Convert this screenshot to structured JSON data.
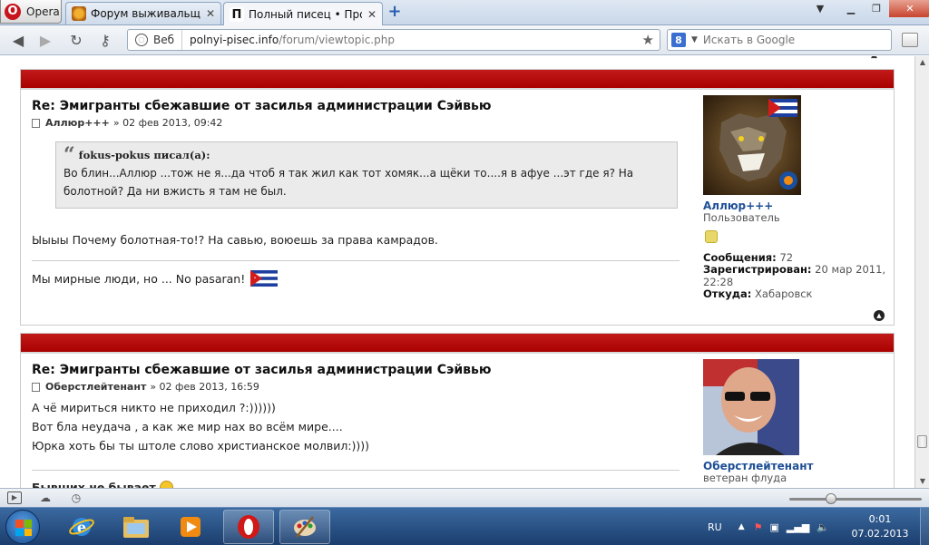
{
  "browser": {
    "menu_label": "Opera",
    "tabs": [
      {
        "title": "Форум выживальщик...",
        "active": false
      },
      {
        "title": "Полный писец • Прос...",
        "active": true
      }
    ],
    "favicon_letter": "П",
    "address": {
      "web_label": "Веб",
      "url_host": "polnyi-pisec.info",
      "url_path": "/forum/viewtopic.php"
    },
    "search": {
      "engine_letter": "8",
      "placeholder": "Искать в Google"
    }
  },
  "posts": [
    {
      "title": "Re: Эмигранты сбежавшие от засилья администрации Сэйвью",
      "author": "Аллюр+++",
      "date": "» 02 фев 2013, 09:42",
      "quote": {
        "cite": "fokus-pokus писал(а):",
        "text": "Во блин...Аллюр ...тож не я...да чтоб я так жил как тот хомяк...а щёки то....я в афуе ...эт где я? На болотной? Да ни вжисть я там не был."
      },
      "text": "Ыыыы Почему болотная-то!? На савью, воюешь за права камрадов.",
      "signature": "Мы мирные люди, но ... No pasaran!",
      "profile": {
        "username": "Аллюр+++",
        "rank": "Пользователь",
        "posts_label": "Сообщения:",
        "posts_value": "72",
        "reg_label": "Зарегистрирован:",
        "reg_value": "20 мар 2011, 22:28",
        "from_label": "Откуда:",
        "from_value": "Хабаровск"
      }
    },
    {
      "title": "Re: Эмигранты сбежавшие от засилья администрации Сэйвью",
      "author": "Оберстлейтенант",
      "date": "» 02 фев 2013, 16:59",
      "lines": [
        "А чё мириться никто не приходил ?:))))))",
        "Вот бла неудача , а как же мир нах во всём мире....",
        "Юрка хоть бы ты штоле слово христианское молвил:))))"
      ],
      "signature": "Бывших не бывает",
      "profile": {
        "username": "Оберстлейтенант",
        "rank": "ветеран флуда"
      }
    }
  ],
  "taskbar": {
    "lang": "RU",
    "time": "0:01",
    "date": "07.02.2013"
  }
}
